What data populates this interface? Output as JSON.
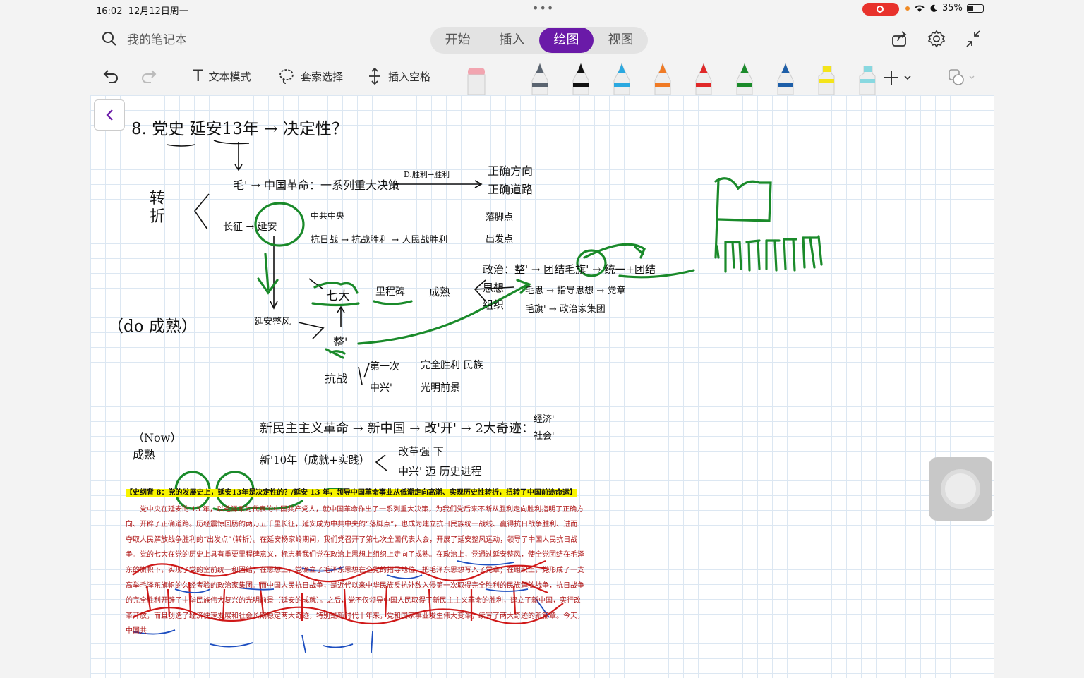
{
  "status_bar": {
    "time": "16:02",
    "date": "12月12日周一",
    "battery": "35%"
  },
  "header": {
    "notebook_title": "我的笔记本",
    "tabs": [
      {
        "label": "开始",
        "active": false
      },
      {
        "label": "插入",
        "active": false
      },
      {
        "label": "绘图",
        "active": true
      },
      {
        "label": "视图",
        "active": false
      }
    ]
  },
  "toolbar": {
    "text_mode": "文本模式",
    "lasso_select": "套索选择",
    "insert_space": "插入空格",
    "pen_colors": [
      "#5a6470",
      "#111111",
      "#2aa8e0",
      "#f07a24",
      "#e02828",
      "#1a8a2a",
      "#1d5ea8",
      "#f4e41a",
      "#88d8e0"
    ]
  },
  "notes": {
    "line1": "8. 党史 延安13年 → 决定性？",
    "mao": "毛' → 中国革命：一系列重大决策",
    "arrow_label": "D.胜利→胜利",
    "right1": "正确方向",
    "right2": "正确道路",
    "zhuanzhe": "转折",
    "changzheng": "长征 → 延安",
    "zhonggong": "中共中央",
    "kangri": "抗日战 → 抗战胜利 → 人民战胜利",
    "luojiao": "落脚点",
    "chufa": "出发点",
    "qida": "七大",
    "licheng": "里程碑",
    "chengshu": "成熟",
    "zhengzhi": "政治：整' → 团结毛旗' → 统一+团结",
    "sixiang": "思想",
    "zuzhi": "组织",
    "maosi": "毛思 → 指导思想 → 党章",
    "maoqi": "毛旗' → 政治家集团",
    "yanan_zf": "延安整风",
    "zheng": "整'",
    "do_chengshu": "（do 成熟）",
    "kangzhan": "抗战",
    "diyici": "第一次",
    "minzu": "完全胜利 民族",
    "zhongxing": "中兴'",
    "guangming": "光明前景",
    "now_chengshu": "（Now）成熟",
    "xinmin": "新民主主义革命 → 新中国 → 改'开' → 2大奇迹：",
    "qiji1": "经济'",
    "qiji2": "社会'",
    "xin10": "新'10年（成就+实践）",
    "bianhua": "改革强 下",
    "zhongxing2": "中兴' 迈 历史进程"
  },
  "document": {
    "heading": "【史纲背 8：党的发展史上，延安13年是决定性的？/延安 13 年，领导中国革命事业从低潮走向高潮、实现历史性转折，扭转了中国前途命运】",
    "body": "党中央在延安的 13 年，以毛泽东为代表的中国共产党人，就中国革命作出了一系列重大决策，为我们党后来不断从胜利走向胜利指明了正确方向、开辟了正确道路。历经震惊回肠的两万五千里长征，延安成为中共中央的“落脚点”，也成为建立抗日民族统一战线、赢得抗日战争胜利、进而夺取人民解放战争胜利的“出发点”（转折）。在延安杨家岭期间，我们党召开了第七次全国代表大会，开展了延安整风运动，领导了中国人民抗日战争。党的七大在党的历史上具有重要里程碑意义，标志着我们党在政治上思想上组织上走向了成熟。在政治上，党通过延安整风，使全党团结在毛泽东的旗帜下，实现了党的空前统一和团结；在思想上，党确立了毛泽东思想在全党的指导地位，把毛泽东思想写入了党章；在组织上，党形成了一支高举毛泽东旗帜的久经考验的政治家集团。而中国人民抗日战争，是近代以来中华民族反抗外敌入侵第一次取得完全胜利的民族解放战争，抗日战争的完全胜利开辟了中华民族伟大复兴的光明前景（延安的成就）。之后，党不仅领导中国人民取得了新民主主义革命的胜利，建立了新中国，实行改革开放，而且创造了经济快速发展和社会长期稳定两大奇迹，特别是新时代十年来，党和国家事业发生伟大变革，续写了两大奇迹的新篇章。今天，中国共"
  }
}
